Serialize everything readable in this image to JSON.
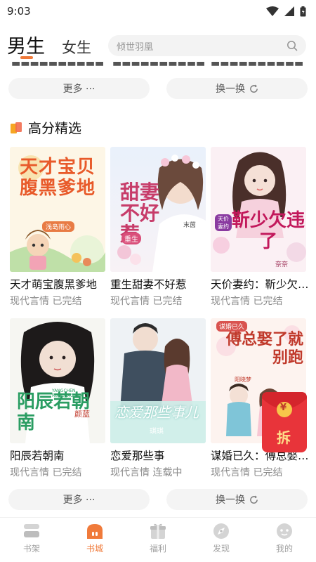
{
  "status": {
    "time": "9:03"
  },
  "tabs": {
    "male": "男生",
    "female": "女生"
  },
  "search": {
    "placeholder": "倾世羽凰"
  },
  "actions": {
    "more": "更多 ···",
    "refresh": "换一换"
  },
  "section": {
    "title": "高分精选"
  },
  "books": [
    {
      "title": "天才萌宝腹黑爹地",
      "category": "现代言情",
      "status": "已完结",
      "cover_text": "天才宝贝腹黑爹地",
      "cover_author": "浅岛雨心"
    },
    {
      "title": "重生甜妻不好惹",
      "category": "现代言情",
      "status": "已完结",
      "cover_text": "甜妻不好惹",
      "cover_badge": "重生",
      "cover_author": "末茵"
    },
    {
      "title": "天价妻约：靳少欠违了",
      "category": "现代言情",
      "status": "已完结",
      "cover_text": "靳少欠违了",
      "cover_badge": "天价妻约",
      "cover_author": "奈奈"
    },
    {
      "title": "阳辰若朝南",
      "category": "现代言情",
      "status": "已完结",
      "cover_text": "阳辰若朝南",
      "cover_subtitle": "YANGCHEN RUOCHAONAN",
      "cover_author": "颜蓝"
    },
    {
      "title": "恋爱那些事",
      "category": "现代言情",
      "status": "连载中",
      "cover_text": "恋爱那些事儿",
      "cover_author": "琪琪"
    },
    {
      "title": "谋婚已久：傅总娶了就别跑",
      "category": "现代言情",
      "status": "已完结",
      "cover_text": "傅总娶了就别跑",
      "cover_badge": "谋婚已久",
      "cover_author": "阳晓梦"
    }
  ],
  "red_packet": {
    "label": "拆",
    "coin": "¥"
  },
  "bottom_nav": [
    {
      "label": "书架",
      "icon": "bookshelf-icon",
      "active": false
    },
    {
      "label": "书城",
      "icon": "bookstore-icon",
      "active": true
    },
    {
      "label": "福利",
      "icon": "gift-icon",
      "active": false
    },
    {
      "label": "发现",
      "icon": "discover-icon",
      "active": false
    },
    {
      "label": "我的",
      "icon": "profile-icon",
      "active": false
    }
  ],
  "colors": {
    "accent": "#f07a3a",
    "red_packet": "#e8343a",
    "muted": "#8a8a8a"
  }
}
